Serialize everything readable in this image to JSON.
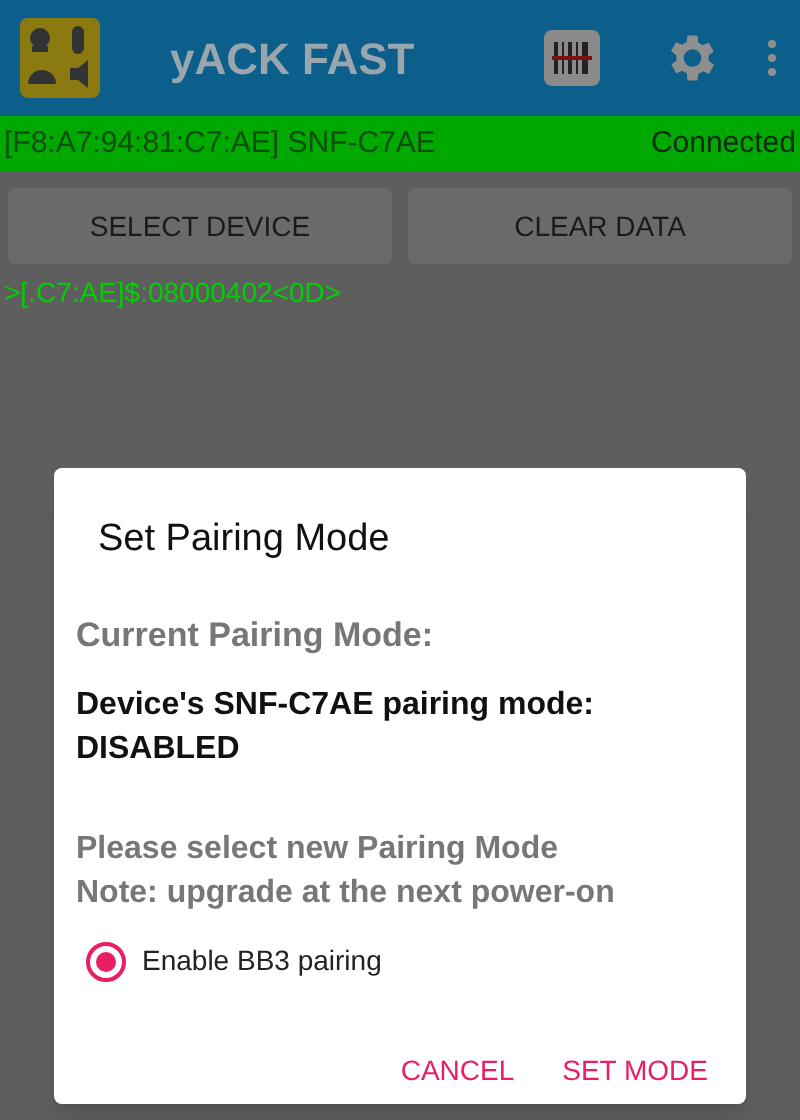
{
  "app_bar": {
    "title": "yACK FAST"
  },
  "status_bar": {
    "device": "[F8:A7:94:81:C7:AE] SNF-C7AE",
    "state": "Connected"
  },
  "buttons": [
    "SELECT DEVICE",
    "CLEAR DATA"
  ],
  "log": [
    ">[.C7:AE]$:08000402<0D>"
  ],
  "dialog": {
    "title": "Set Pairing Mode",
    "current_label": "Current Pairing Mode:",
    "current_value": "Device's SNF-C7AE pairing mode: DISABLED",
    "prompt": "Please select new Pairing Mode\nNote: upgrade at the next power-on",
    "options": [
      {
        "label": "Enable BB3 pairing",
        "selected": true
      }
    ],
    "actions": [
      "CANCEL",
      "SET MODE"
    ]
  }
}
